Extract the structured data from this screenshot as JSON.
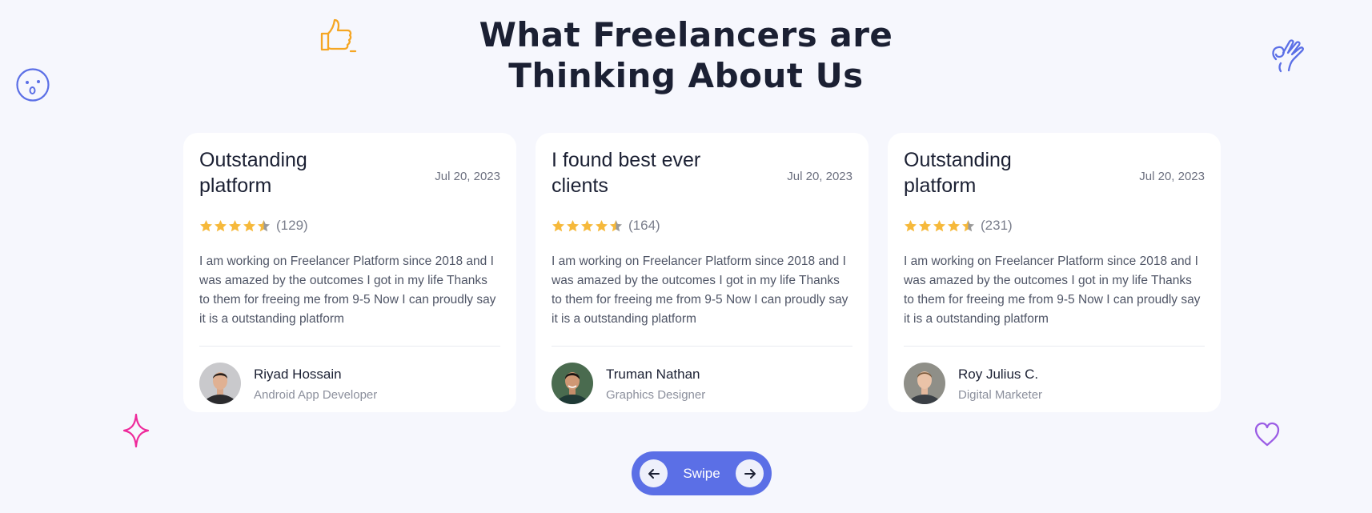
{
  "heading": {
    "line1": "What Freelancers are",
    "line2": "Thinking About Us"
  },
  "decorations": {
    "thumbs_up_color": "#f5a623",
    "surprised_face_color": "#5b6fe6",
    "ok_hand_color": "#5b6fe6",
    "sparkle_color": "#ee2a9b",
    "heart_color": "#9b5de5"
  },
  "star_color": "#f6b93b",
  "star_empty_color": "#9a9a9a",
  "testimonials": [
    {
      "title": "Outstanding platform",
      "date": "Jul 20, 2023",
      "rating": 4.5,
      "count": "(129)",
      "text": "I am working on Freelancer Platform since 2018 and I was amazed by the outcomes I got in my life Thanks to them for freeing me from 9-5 Now I can proudly say it is a outstanding platform",
      "name": "Riyad Hossain",
      "role": "Android App Developer"
    },
    {
      "title": "I found best ever clients",
      "date": "Jul 20, 2023",
      "rating": 4.5,
      "count": "(164)",
      "text": "I am working on Freelancer Platform since 2018 and I was amazed by the outcomes I got in my life Thanks to them for freeing me from 9-5 Now I can proudly say it is a outstanding platform",
      "name": "Truman Nathan",
      "role": "Graphics Designer"
    },
    {
      "title": "Outstanding platform",
      "date": "Jul 20, 2023",
      "rating": 4.5,
      "count": "(231)",
      "text": "I am working on Freelancer Platform since 2018 and I was amazed by the outcomes I got in my life Thanks to them for freeing me from 9-5 Now I can proudly say it is a outstanding platform",
      "name": "Roy Julius C.",
      "role": "Digital Marketer"
    }
  ],
  "swipe": {
    "label": "Swipe",
    "prev_icon": "arrow-left-icon",
    "next_icon": "arrow-right-icon"
  }
}
